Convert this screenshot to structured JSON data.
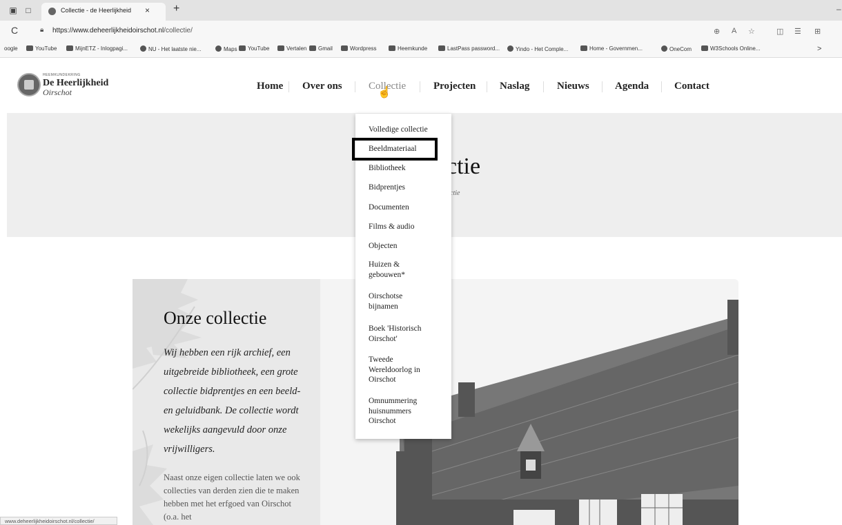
{
  "browser": {
    "tab_title": "Collectie - de Heerlijkheid",
    "tab_close": "×",
    "new_tab": "+",
    "minimize": "–",
    "reload": "C",
    "url_host": "https://www.deheerlijkheidoirschot.nl",
    "url_path": "/collectie/",
    "bookmarks": [
      {
        "label": "oogle"
      },
      {
        "label": "YouTube"
      },
      {
        "label": "MijnETZ - Inlogpagi..."
      },
      {
        "label": "NU - Het laatste nie..."
      },
      {
        "label": "Maps"
      },
      {
        "label": "YouTube"
      },
      {
        "label": "Vertalen"
      },
      {
        "label": "Gmail"
      },
      {
        "label": "Wordpress"
      },
      {
        "label": "Heemkunde"
      },
      {
        "label": "LastPass password..."
      },
      {
        "label": "Yindo - Het Comple..."
      },
      {
        "label": "Home - Governmen..."
      },
      {
        "label": "OneCom"
      },
      {
        "label": "W3Schools Online..."
      }
    ],
    "bookmarks_more": ">",
    "status_url": "www.deheerlijkheidoirschot.nl/collectie/"
  },
  "site": {
    "logo_small": "HEEMKUNDEKRING",
    "logo_main": "De Heerlijkheid",
    "logo_sub": "Oirschot",
    "nav": {
      "home": "Home",
      "over_ons": "Over ons",
      "collectie": "Collectie",
      "projecten": "Projecten",
      "naslag": "Naslag",
      "nieuws": "Nieuws",
      "agenda": "Agenda",
      "contact": "Contact"
    },
    "dropdown": {
      "volledige": "Volledige collectie",
      "beeldmateriaal": "Beeldmateriaal",
      "bibliotheek": "Bibliotheek",
      "bidprentjes": "Bidprentjes",
      "documenten": "Documenten",
      "films": "Films & audio",
      "objecten": "Objecten",
      "huizen": "Huizen & gebouwen*",
      "bijnamen": "Oirschotse bijnamen",
      "boek": "Boek 'Historisch Oirschot'",
      "wo2": "Tweede Wereldoorlog in Oirschot",
      "omnummering": "Omnummering huisnummers Oirschot"
    },
    "hero_title_visible": "ctie",
    "hero_crumb_visible": "ctie",
    "content_title": "Onze collectie",
    "content_intro": "Wij hebben een rijk archief, een uitgebreide bibliotheek, een grote collectie bidprentjes en een beeld- en geluidbank. De collectie wordt wekelijks aangevuld door onze vrijwilligers.",
    "content_body": "Naast onze eigen collectie laten we ook collecties van derden zien die te maken hebben met het erfgoed van Oirschot (o.a. het"
  },
  "colors": {
    "hero_bg": "#eeeeee",
    "highlight": "#000000",
    "text": "#222222"
  }
}
